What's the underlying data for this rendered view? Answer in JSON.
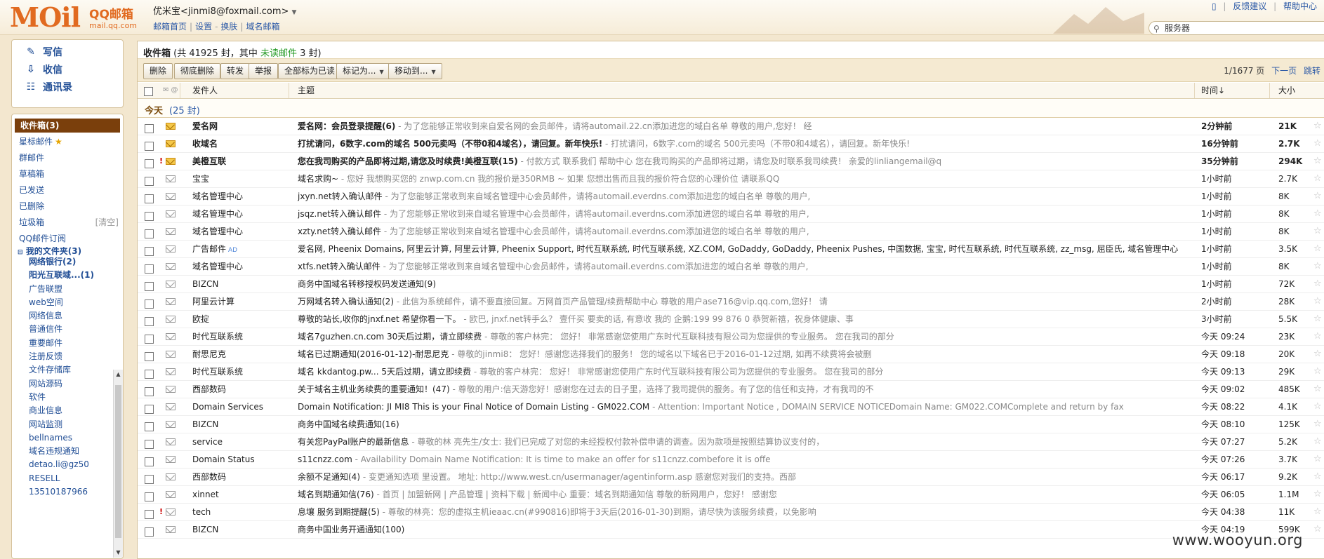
{
  "brand": {
    "logo": "MOil",
    "qq": "QQ邮箱",
    "domain": "mail.qq.com"
  },
  "account": {
    "name": "优米宝<jinmi8@foxmail.com>",
    "links": [
      "邮箱首页",
      "设置",
      "换肤",
      "域名邮箱"
    ]
  },
  "top_links": [
    "反馈建议",
    "帮助中心"
  ],
  "search": {
    "value": "服务器"
  },
  "sidebar": {
    "actions": [
      {
        "label": "写信",
        "icon": "compose-icon"
      },
      {
        "label": "收信",
        "icon": "inbox-download-icon"
      },
      {
        "label": "通讯录",
        "icon": "contacts-icon"
      }
    ],
    "folders": [
      {
        "label": "收件箱(3)",
        "active": true
      },
      {
        "label": "星标邮件"
      },
      {
        "label": "群邮件"
      },
      {
        "label": "草稿箱"
      },
      {
        "label": "已发送"
      },
      {
        "label": "已删除"
      },
      {
        "label": "垃圾箱",
        "extra": "[清空]"
      },
      {
        "label": "QQ邮件订阅"
      }
    ],
    "my_folders_label": "我的文件夹(3)",
    "my_folders": [
      {
        "label": "网络银行(2)",
        "bold": true
      },
      {
        "label": "阳光互联域...(1)",
        "bold": true
      },
      {
        "label": "广告联盟"
      },
      {
        "label": "web空间"
      },
      {
        "label": "网络信息"
      },
      {
        "label": "普通信件"
      },
      {
        "label": "重要邮件"
      },
      {
        "label": "注册反馈"
      },
      {
        "label": "文件存储库"
      },
      {
        "label": "网站源码"
      },
      {
        "label": "软件"
      },
      {
        "label": "商业信息"
      },
      {
        "label": "网站监测"
      },
      {
        "label": "bellnames"
      },
      {
        "label": "域名违规通知"
      },
      {
        "label": "detao.li@gz50"
      },
      {
        "label": "RESELL"
      },
      {
        "label": "13510187966"
      }
    ]
  },
  "inbox": {
    "title": "收件箱",
    "summary_pre": "(共 41925 封，其中",
    "unread_link": "未读邮件",
    "summary_post": "3 封)"
  },
  "toolbar": {
    "buttons": [
      "删除",
      "彻底删除",
      "转发",
      "举报",
      "全部标为已读"
    ],
    "dropdowns": [
      "标记为...",
      "移动到..."
    ],
    "pager": {
      "page": "1/1677 页",
      "next": "下一页",
      "jump": "跳转"
    }
  },
  "columns": {
    "from": "发件人",
    "subject": "主题",
    "time": "时间↓",
    "size": "大小"
  },
  "group": {
    "label": "今天",
    "count": "(25 封)"
  },
  "emails": [
    {
      "from": "爱名网",
      "subject": "爱名网：会员登录提醒(6)",
      "preview": " - 为了您能够正常收到来自爱名网的会员邮件，请将automail.22.cn添加进您的域白名单 尊敬的用户,您好！ 经",
      "time": "2分钟前",
      "size": "21K",
      "unread": true,
      "flag": false
    },
    {
      "from": "收域名",
      "subject": "打扰请问，6数字.com的域名 500元卖吗（不带0和4域名），请回复。新年快乐!",
      "preview": " - 打扰请问，6数字.com的域名 500元卖吗（不带0和4域名），请回复。新年快乐!",
      "time": "16分钟前",
      "size": "2.7K",
      "unread": true,
      "flag": false
    },
    {
      "from": "美橙互联",
      "subject": "您在我司购买的产品即将过期,请您及时续费!美橙互联(15)",
      "preview": " - 付款方式 联系我们 帮助中心 您在我司购买的产品即将过期，请您及时联系我司续费！ 亲爱的linliangemail@q",
      "time": "35分钟前",
      "size": "294K",
      "unread": true,
      "flag": true
    },
    {
      "from": "宝宝",
      "subject": "域名求购~",
      "preview": " - 您好 我想购买您的 znwp.com.cn 我的报价是350RMB ~ 如果 您想出售而且我的报价符合您的心理价位 请联系QQ",
      "time": "1小时前",
      "size": "2.7K",
      "unread": false,
      "flag": false
    },
    {
      "from": "域名管理中心",
      "subject": "jxyn.net转入确认邮件",
      "preview": " - 为了您能够正常收到来自域名管理中心会员邮件，请将automail.everdns.com添加进您的域白名单 尊敬的用户,",
      "time": "1小时前",
      "size": "8K",
      "unread": false,
      "flag": false
    },
    {
      "from": "域名管理中心",
      "subject": "jsqz.net转入确认邮件",
      "preview": " - 为了您能够正常收到来自域名管理中心会员邮件，请将automail.everdns.com添加进您的域白名单 尊敬的用户,",
      "time": "1小时前",
      "size": "8K",
      "unread": false,
      "flag": false
    },
    {
      "from": "域名管理中心",
      "subject": "xzty.net转入确认邮件",
      "preview": " - 为了您能够正常收到来自域名管理中心会员邮件，请将automail.everdns.com添加进您的域白名单 尊敬的用户,",
      "time": "1小时前",
      "size": "8K",
      "unread": false,
      "flag": false
    },
    {
      "from": "广告邮件",
      "from_tag": "AD",
      "subject": "爱名网, Pheenix Domains, 阿里云计算, 阿里云计算, Pheenix Support, 时代互联系统, 时代互联系统, XZ.COM, GoDaddy, GoDaddy, Pheenix Pushes, 中国数据, 宝宝, 时代互联系统, 时代互联系统, zz_msg, 屈臣氏, 域名管理中心",
      "preview": "",
      "time": "1小时前",
      "size": "3.5K",
      "unread": false,
      "flag": false
    },
    {
      "from": "域名管理中心",
      "subject": "xtfs.net转入确认邮件",
      "preview": " - 为了您能够正常收到来自域名管理中心会员邮件，请将automail.everdns.com添加进您的域白名单 尊敬的用户,",
      "time": "1小时前",
      "size": "8K",
      "unread": false,
      "flag": false
    },
    {
      "from": "BIZCN",
      "subject": "商务中国域名转移授权码发送通知(9)",
      "preview": "",
      "time": "1小时前",
      "size": "72K",
      "unread": false,
      "flag": false
    },
    {
      "from": "阿里云计算",
      "subject": "万网域名转入确认通知(2)",
      "preview": " - 此信为系统邮件，请不要直接回复。万网首页产品管理/续费帮助中心 尊敬的用户ase716@vip.qq.com,您好！ 请",
      "time": "2小时前",
      "size": "28K",
      "unread": false,
      "flag": false
    },
    {
      "from": "欧掟",
      "subject": "尊敬的站长,收你的jnxf.net 希望你看一下。",
      "preview": " - 欧巴, jnxf.net转手么？ 壹仟买 要卖的话, 有意收 我的 企鹅:199 99 876 0      恭贺新禧，祝身体健康、事",
      "time": "3小时前",
      "size": "5.5K",
      "unread": false,
      "flag": false
    },
    {
      "from": "时代互联系统",
      "subject": "域名7guzhen.cn.com 30天后过期，请立即续费",
      "preview": " - 尊敬的客户林完： 您好！ 非常感谢您使用广东时代互联科技有限公司为您提供的专业服务。 您在我司的部分",
      "time": "今天 09:24",
      "size": "23K",
      "unread": false,
      "flag": false
    },
    {
      "from": "耐思尼克",
      "subject": "域名已过期通知(2016-01-12)-耐思尼克",
      "preview": " - 尊敬的jinmi8： 您好！感谢您选择我们的服务！ 您的域名以下域名已于2016-01-12过期, 如再不续费将会被删",
      "time": "今天 09:18",
      "size": "20K",
      "unread": false,
      "flag": false
    },
    {
      "from": "时代互联系统",
      "subject": "域名 kkdantog.pw... 5天后过期，请立即续费",
      "preview": " - 尊敬的客户林完： 您好！ 非常感谢您使用广东时代互联科技有限公司为您提供的专业服务。 您在我司的部分",
      "time": "今天 09:13",
      "size": "29K",
      "unread": false,
      "flag": false
    },
    {
      "from": "西部数码",
      "subject": "关于域名主机业务续费的重要通知！(47)",
      "preview": " - 尊敬的用户:信天游您好！感谢您在过去的日子里，选择了我司提供的服务。有了您的信任和支持，才有我司的不",
      "time": "今天 09:02",
      "size": "485K",
      "unread": false,
      "flag": false
    },
    {
      "from": "Domain Services",
      "subject": "Domain Notification: JI MI8 This is your Final Notice of Domain Listing - GM022.COM",
      "preview": " - Attention: Important Notice , DOMAIN SERVICE NOTICEDomain Name: GM022.COMComplete and return by fax",
      "time": "今天 08:22",
      "size": "4.1K",
      "unread": false,
      "flag": false
    },
    {
      "from": "BIZCN",
      "subject": "商务中国域名续费通知(16)",
      "preview": "",
      "time": "今天 08:10",
      "size": "125K",
      "unread": false,
      "flag": false
    },
    {
      "from": "service",
      "subject": "有关您PayPal账户的最新信息",
      "preview": " - 尊敬的林 亮先生/女士: 我们已完成了对您的未经授权付款补偿申请的调查。因为款项是按照结算协议支付的，",
      "time": "今天 07:27",
      "size": "5.2K",
      "unread": false,
      "flag": false
    },
    {
      "from": "Domain Status",
      "subject": "s11cnzz.com",
      "preview": " - Availability Domain Name Notification: It is time to make an offer for s11cnzz.combefore it is offe",
      "time": "今天 07:26",
      "size": "3.7K",
      "unread": false,
      "flag": false
    },
    {
      "from": "西部数码",
      "subject": "余额不足通知(4)",
      "preview": " - 变更通知选项 里设置。 地址: http://www.west.cn/usermanager/agentinform.asp 感谢您对我们的支持。西部",
      "time": "今天 06:17",
      "size": "9.2K",
      "unread": false,
      "flag": false
    },
    {
      "from": "xinnet",
      "subject": "域名到期通知信(76)",
      "preview": " - 首页 | 加盟新网 | 产品管理 | 资料下载 | 新闻中心 重要：域名到期通知信 尊敬的新网用户，您好！ 感谢您",
      "time": "今天 06:05",
      "size": "1.1M",
      "unread": false,
      "flag": false
    },
    {
      "from": "tech",
      "subject": "息壤 服务到期提醒(5)",
      "preview": " - 尊敬的林亮：您的虚拟主机ieaac.cn(#990816)即将于3天后(2016-01-30)到期，请尽快为该服务续费，以免影响",
      "time": "今天 04:38",
      "size": "11K",
      "unread": false,
      "flag": true
    },
    {
      "from": "BIZCN",
      "subject": "商务中国业务开通通知(100)",
      "preview": "",
      "time": "今天 04:19",
      "size": "599K",
      "unread": false,
      "flag": false
    }
  ],
  "watermark": "www.wooyun.org"
}
